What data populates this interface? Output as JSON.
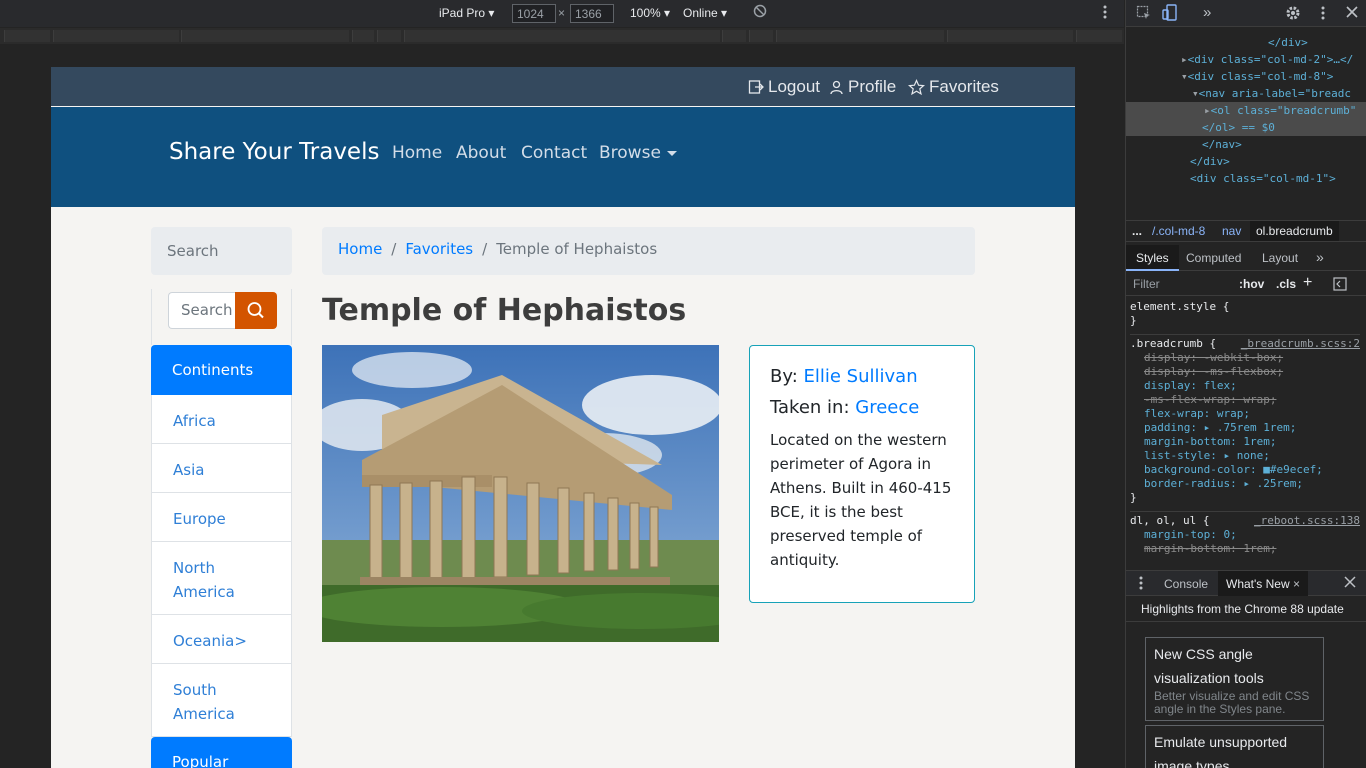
{
  "device_toolbar": {
    "device": "iPad Pro",
    "width": "1024",
    "height": "1366",
    "zoom": "100%",
    "throttle": "Online",
    "times": "×"
  },
  "page": {
    "topbar": {
      "logout": "Logout",
      "profile": "Profile",
      "favorites": "Favorites"
    },
    "nav": {
      "brand": "Share Your Travels",
      "links": [
        "Home",
        "About",
        "Contact",
        "Browse"
      ]
    },
    "sidebar": {
      "search_heading": "Search",
      "search_placeholder": "Search",
      "continents_header": "Continents",
      "continents": [
        "Africa",
        "Asia",
        "Europe",
        "North America",
        "Oceania>",
        "South America"
      ],
      "popular_header": "Popular"
    },
    "breadcrumb": [
      "Home",
      "Favorites",
      "Temple of Hephaistos"
    ],
    "breadcrumb_sep": "/",
    "title": "Temple of Hephaistos",
    "info": {
      "by_label": "By:",
      "by_value": "Ellie Sullivan",
      "taken_label": "Taken in:",
      "taken_value": "Greece",
      "description": "Located on the western perimeter of Agora in Athens. Built in 460-415 BCE, it is the best preserved temple of antiquity."
    }
  },
  "devtools": {
    "dom_lines": [
      {
        "text": "</div>"
      },
      {
        "text": "<div class=\"col-md-2\">…</"
      },
      {
        "text": "<div class=\"col-md-8\">"
      },
      {
        "text": "<nav aria-label=\"breadc"
      },
      {
        "text": "<ol class=\"breadcrumb\""
      },
      {
        "text": "</ol> == $0"
      },
      {
        "text": "</nav>"
      },
      {
        "text": "</div>"
      },
      {
        "text": "<div class=\"col-md-1\">"
      }
    ],
    "crumbs": [
      "...",
      "/.col-md-8",
      "nav",
      "ol.breadcrumb"
    ],
    "style_tabs": [
      "Styles",
      "Computed",
      "Layout",
      "»"
    ],
    "filter_placeholder": "Filter",
    "hov": ":hov",
    "cls": ".cls",
    "element_style": "element.style {",
    "close_brace": "}",
    "rule1": {
      "selector": ".breadcrumb {",
      "source": "_breadcrumb.scss:2",
      "props": [
        {
          "text": "display: -webkit-box;",
          "strike": true
        },
        {
          "text": "display: -ms-flexbox;",
          "strike": true
        },
        {
          "text": "display: flex;",
          "strike": false
        },
        {
          "text": "-ms-flex-wrap: wrap;",
          "strike": true
        },
        {
          "text": "flex-wrap: wrap;",
          "strike": false
        },
        {
          "text": "padding: ▸ .75rem 1rem;",
          "strike": false
        },
        {
          "text": "margin-bottom: 1rem;",
          "strike": false
        },
        {
          "text": "list-style: ▸ none;",
          "strike": false
        },
        {
          "text": "background-color: ■#e9ecef;",
          "strike": false
        },
        {
          "text": "border-radius: ▸ .25rem;",
          "strike": false
        }
      ]
    },
    "rule2": {
      "selector": "dl, ol, ul {",
      "source": "_reboot.scss:138",
      "props": [
        {
          "text": "margin-top: 0;",
          "strike": false
        },
        {
          "text": "margin-bottom: 1rem;",
          "strike": true
        }
      ]
    },
    "drawer_tabs": [
      "Console",
      "What's New"
    ],
    "whatsnew_heading": "Highlights from the Chrome 88 update",
    "cards": [
      {
        "title": "New CSS angle visualization tools",
        "desc": "Better visualize and edit CSS angle in the Styles pane."
      },
      {
        "title": "Emulate unsupported image types",
        "desc": ""
      }
    ]
  },
  "colors": {
    "topbar": "#34495e",
    "navbar": "#0f507f",
    "primary": "#007bff",
    "search_button": "#d35400",
    "card_border": "#17a2b8"
  }
}
